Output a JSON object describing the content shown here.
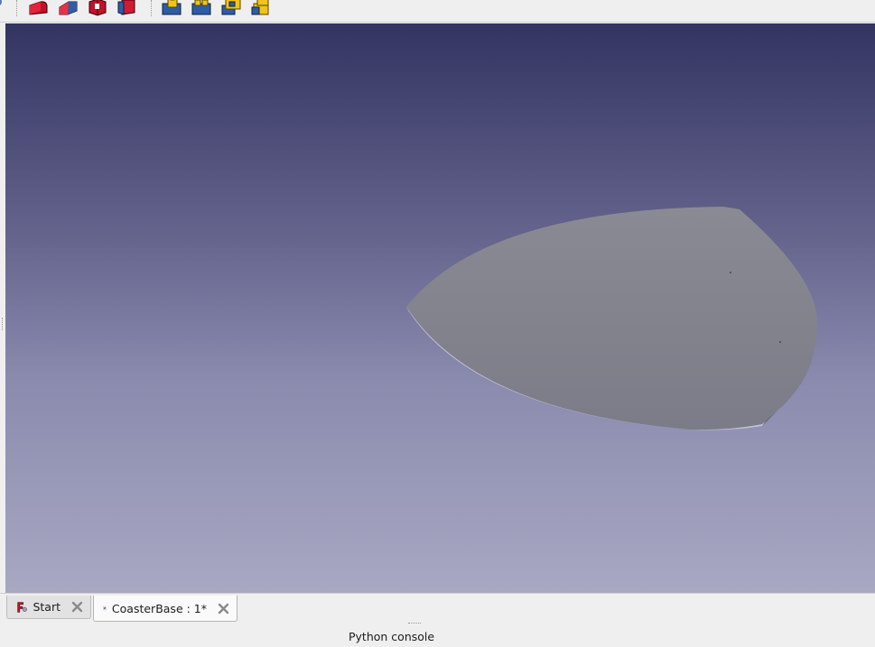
{
  "toolbar": {
    "buttons": [
      {
        "icon": "part-fillet-icon"
      },
      {
        "icon": "part-chamfer-icon"
      },
      {
        "icon": "part-extrude-icon"
      },
      {
        "icon": "part-revolve-icon"
      },
      {
        "icon": "part-boolean-icon"
      },
      {
        "icon": "part-cut-icon"
      },
      {
        "icon": "part-fuse-icon"
      },
      {
        "icon": "part-common-icon"
      }
    ]
  },
  "viewport": {
    "background_top": "#333461",
    "background_bottom": "#a8a8c3",
    "object": "CoasterBase shape",
    "object_color": "#85858f"
  },
  "tabs": [
    {
      "label": "Start",
      "icon": "freecad-start-icon",
      "active": false
    },
    {
      "label": "CoasterBase : 1*",
      "icon": "document-icon",
      "active": true
    }
  ],
  "console": {
    "label": "Python console"
  }
}
